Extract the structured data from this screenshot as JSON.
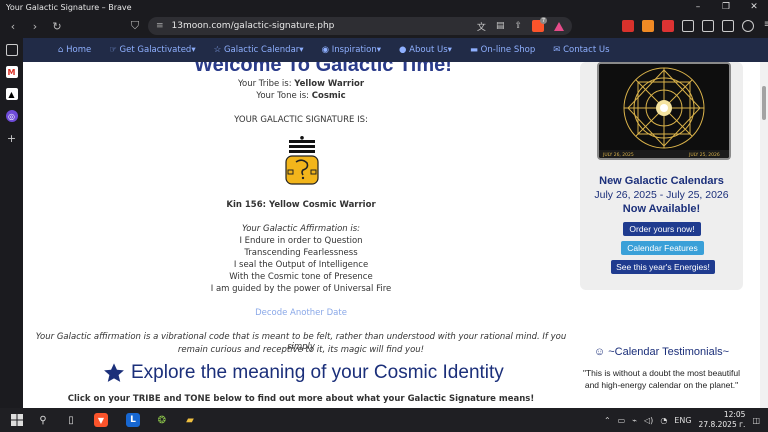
{
  "window": {
    "title": "Your Galactic Signature – Brave"
  },
  "browser": {
    "url": "13moon.com/galactic-signature.php",
    "brave_badge": "7"
  },
  "site_nav": [
    {
      "label": "Home",
      "icon": "home-icon",
      "glyph": "⌂"
    },
    {
      "label": "Get Galactivated",
      "icon": "hand-icon",
      "glyph": "☞",
      "caret": "▾"
    },
    {
      "label": "Galactic Calendar",
      "icon": "star-outline-icon",
      "glyph": "☆",
      "caret": "▾"
    },
    {
      "label": "Inspiration",
      "icon": "globe-icon",
      "glyph": "◉",
      "caret": "▾"
    },
    {
      "label": "About Us",
      "icon": "user-icon",
      "glyph": "●",
      "caret": "▾"
    },
    {
      "label": "On-line Shop",
      "icon": "cart-icon",
      "glyph": "▬"
    },
    {
      "label": "Contact Us",
      "icon": "envelope-icon",
      "glyph": "✉"
    }
  ],
  "main": {
    "welcome": "Welcome To Galactic Time!",
    "tribe_prefix": "Your Tribe is: ",
    "tribe": "Yellow Warrior",
    "tone_prefix": "Your Tone is: ",
    "tone": "Cosmic",
    "signature_heading": "YOUR GALACTIC SIGNATURE IS:",
    "kin": "Kin 156: Yellow Cosmic Warrior",
    "affirmation_heading": "Your Galactic Affirmation is:",
    "affirmation_lines": [
      "I Endure in order to Question",
      "Transcending Fearlessness",
      "I seal the Output of Intelligence",
      "With the Cosmic tone of Presence",
      "I am guided by the power of Universal Fire"
    ],
    "decode_link": "Decode Another Date",
    "explanation_line1": "Your Galactic affirmation is a vibrational code that is meant to be felt, rather than understood with your rational mind. If you simply",
    "explanation_line2": "remain curious and receptive to it, its magic will find you!",
    "explore_heading": "Explore the meaning of your Cosmic Identity",
    "click_instruction": "Click on your TRIBE and TONE below to find out more about what your Galactic Signature means!"
  },
  "side_panel": {
    "title": "New Galactic Calendars",
    "dates": "July 26, 2025 - July 25, 2026",
    "available": "Now Available!",
    "order_button": "Order yours now!",
    "features_button": "Calendar Features",
    "energies_button": "See this year's Energies!",
    "testimonials_title": "☺ ~Calendar Testimonials~",
    "testimonial_quote": "\"This is without a doubt the most beautiful and high-energy calendar on the planet.\"",
    "poster_left_date": "JULY 26, 2025",
    "poster_right_date": "JULY 25, 2026"
  },
  "taskbar": {
    "time": "12:05",
    "date": "27.8.2025 г.",
    "language": "ENG"
  },
  "colors": {
    "site_nav_bg": "#212b47",
    "site_nav_text": "#8fb0ff",
    "heading_blue": "#1b2f7a",
    "order_button": "#1f3b8f",
    "features_button": "#3aa0d8",
    "energies_button": "#1f3b8f",
    "glyph_yellow": "#f2b51b"
  }
}
